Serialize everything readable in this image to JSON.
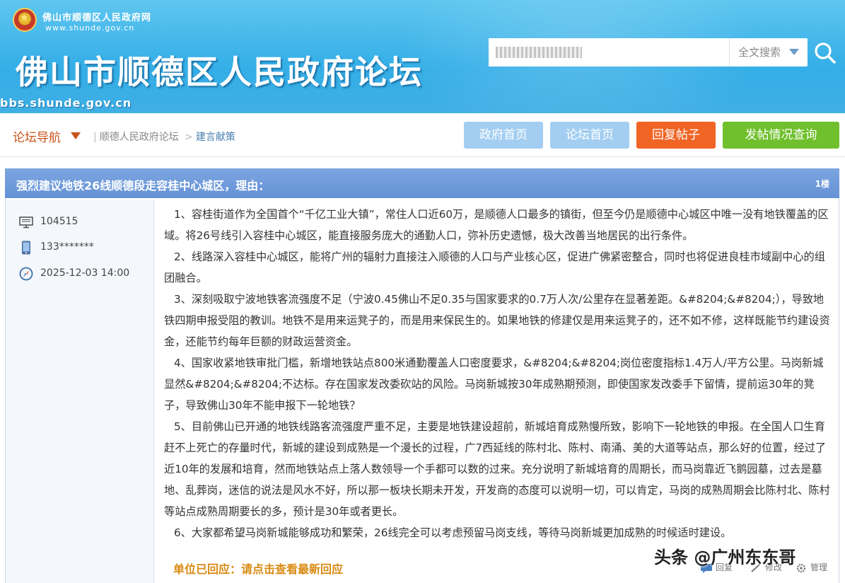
{
  "header": {
    "site_name": "佛山市顺德区人民政府网",
    "site_url": "www.shunde.gov.cn",
    "forum_title": "佛山市顺德区人民政府论坛",
    "forum_url": "bbs.shunde.gov.cn",
    "search": {
      "value": "",
      "type_label": "全文搜索"
    }
  },
  "nav": {
    "label": "论坛导航",
    "breadcrumb": [
      "顺德人民政府论坛",
      "建言献策"
    ],
    "breadcrumb_sep": ">",
    "buttons": {
      "gov_home": "政府首页",
      "forum_home": "论坛首页",
      "reply": "回复帖子",
      "query": "发帖情况查询"
    },
    "colors": {
      "accent": "#c8531a",
      "blue_button": "#a3cef1",
      "reply_button": "#f06424",
      "query_button": "#6fc02c",
      "title_bar": "#6b97d9"
    }
  },
  "post": {
    "title": "强烈建议地铁26线顺德段走容桂中心城区，理由：",
    "floor": "1楼",
    "author": {
      "id": "104515",
      "phone": "133*******",
      "time": "2025-12-03 14:00",
      "icons": [
        "monitor-icon",
        "phone-icon",
        "compass-icon"
      ]
    },
    "paragraphs": [
      "1、容桂街道作为全国首个“千亿工业大镇”，常住人口近60万，是顺德人口最多的镇街，但至今仍是顺德中心城区中唯一没有地铁覆盖的区域。将26号线引入容桂中心城区，能直接服务庞大的通勤人口，弥补历史遗憾，极大改善当地居民的出行条件。",
      "2、线路深入容桂中心城区，能将广州的辐射力直接注入顺德的人口与产业核心区，促进广佛紧密整合，同时也将促进良桂市域副中心的组团融合。",
      "3、深刻吸取宁波地铁客流强度不足（宁波0.45佛山不足0.35与国家要求的0.7万人次/公里存在显著差距。&#8204;&#8204;），导致地铁四期申报受阻的教训。地铁不是用来运凳子的，而是用来保民生的。如果地铁的修建仅是用来运凳子的，还不如不修，这样既能节约建设资金，还能节约每年巨额的财政运营资金。",
      "4、国家收紧地铁审批门槛，新增地铁站点800米通勤覆盖人口密度要求，&#8204;&#8204;岗位密度指标1.4万人/平方公里。马岗新城显然&#8204;&#8204;不达标。存在国家发改委砍站的风险。马岗新城按30年成熟期预测，即使国家发改委手下留情，提前运30年的凳子，导致佛山30年不能申报下一轮地铁？",
      "5、目前佛山已开通的地铁线路客流强度严重不足，主要是地铁建设超前，新城培育成熟慢所致，影响下一轮地铁的申报。在全国人口生育赶不上死亡的存量时代，新城的建设到成熟是一个漫长的过程，广7西延线的陈村北、陈村、南涌、美的大道等站点，那么好的位置，经过了近10年的发展和培育，然而地铁站点上落人数领导一个手都可以数的过来。充分说明了新城培育的周期长，而马岗靠近飞鹅园墓，过去是墓地、乱葬岗，迷信的说法是风水不好，所以那一板块长期未开发，开发商的态度可以说明一切，可以肯定，马岗的成熟周期会比陈村北、陈村等站点成熟周期要长的多，预计是30年或者更长。",
      "6、大家都希望马岗新城能够成功和繁荣，26线完全可以考虑预留马岗支线，等待马岗新城更加成熟的时候适时建设。"
    ],
    "reply_note": "单位已回应：请点击查看最新回应",
    "actions": {
      "reply": "回复",
      "edit": "修改",
      "manage": "管理"
    }
  },
  "watermark": "头条 @广州东东哥"
}
